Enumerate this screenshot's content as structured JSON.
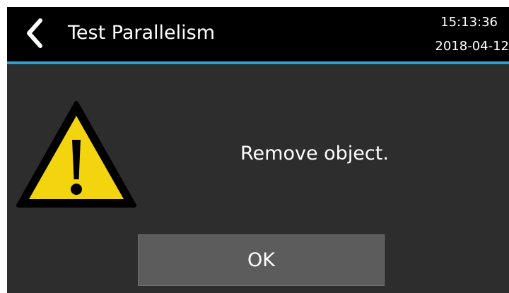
{
  "header": {
    "back_icon": "chevron-left-icon",
    "title": "Test Parallelism",
    "time": "15:13:36",
    "date": "2018-04-12",
    "accent_color": "#29a3d6"
  },
  "dialog": {
    "icon": "warning-triangle-icon",
    "icon_color": "#f2d40f",
    "message": "Remove object.",
    "ok_label": "OK"
  }
}
